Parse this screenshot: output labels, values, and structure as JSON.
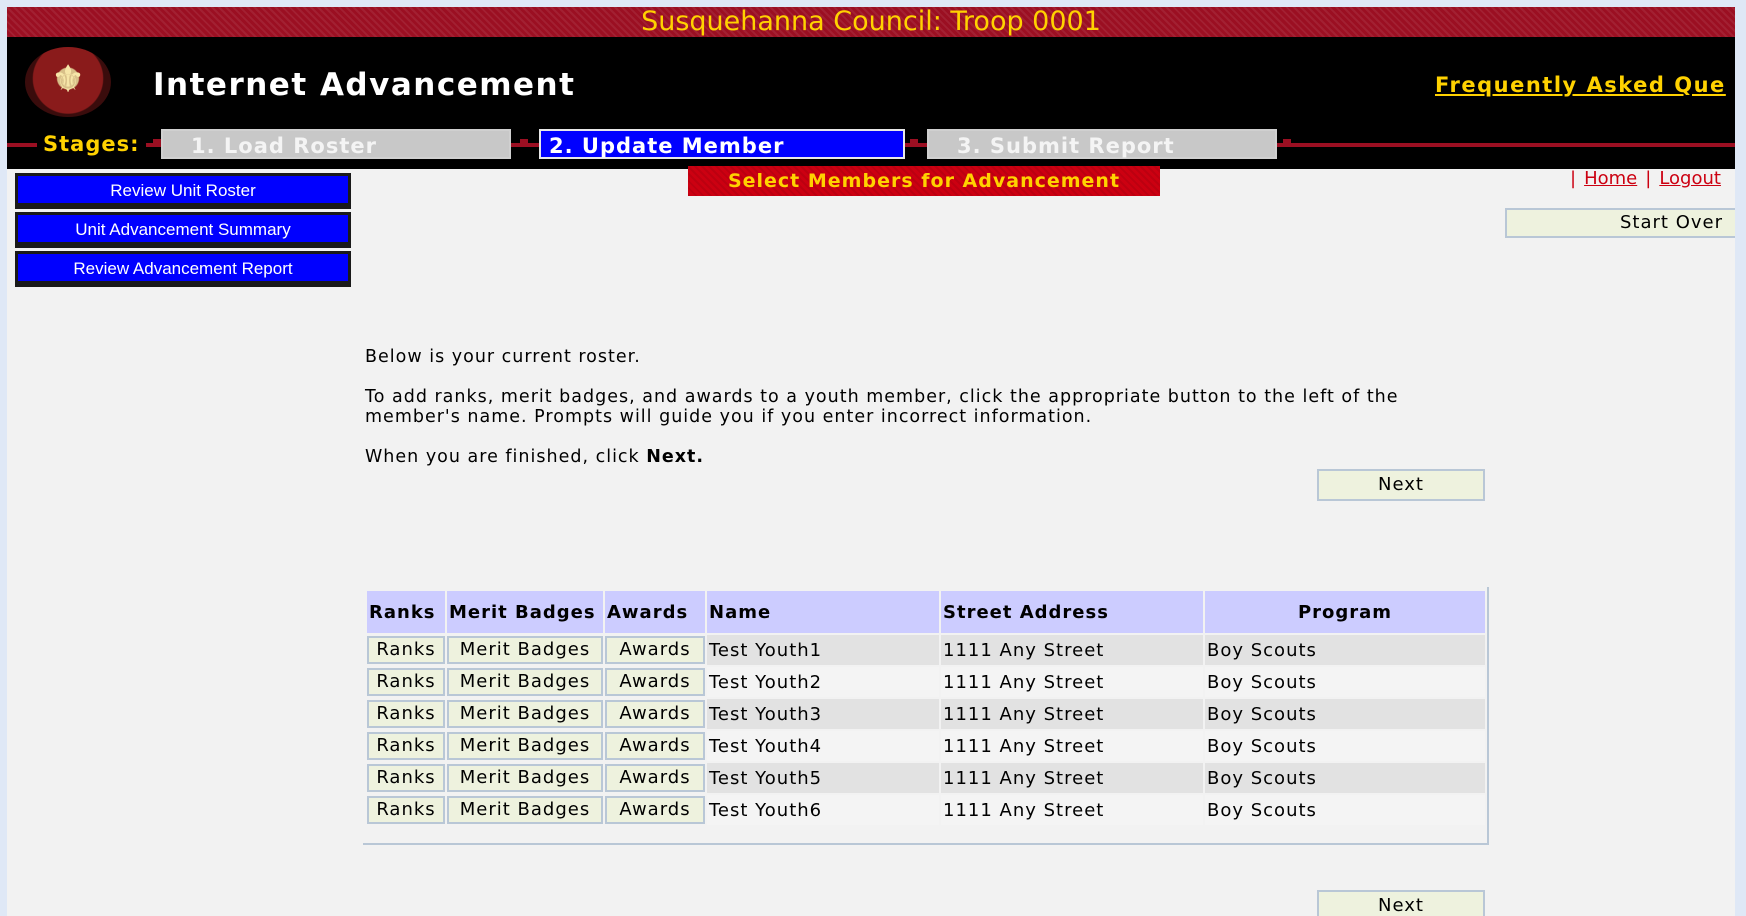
{
  "council_title": "Susquehanna Council: Troop 0001",
  "app_title": "Internet Advancement",
  "faq_link": "Frequently Asked Que",
  "stages": {
    "label": "Stages:",
    "items": [
      {
        "label": "1. Load Roster",
        "state": "inactive"
      },
      {
        "label": "2. Update Member",
        "state": "active"
      },
      {
        "label": "3. Submit Report",
        "state": "inactive"
      }
    ]
  },
  "nav": {
    "items": [
      "Review Unit Roster",
      "Unit Advancement Summary",
      "Review Advancement Report"
    ]
  },
  "section_title": "Select Members for Advancement",
  "top_links": {
    "home": "Home",
    "logout": "Logout"
  },
  "start_over": "Start Over",
  "instructions": {
    "p1": "Below is your current roster.",
    "p2": "To add ranks, merit badges, and awards to a youth member, click the appropriate button to the left of the member's name.  Prompts will guide you if you enter incorrect information.",
    "p3_prefix": "When you are finished, click ",
    "p3_bold": "Next."
  },
  "next_label": "Next",
  "table": {
    "headers": {
      "ranks": "Ranks",
      "merit_badges": "Merit Badges",
      "awards": "Awards",
      "name": "Name",
      "street_address": "Street Address",
      "program": "Program"
    },
    "button_labels": {
      "ranks": "Ranks",
      "merit_badges": "Merit Badges",
      "awards": "Awards"
    },
    "rows": [
      {
        "name": "Test Youth1",
        "address": "1111 Any Street",
        "program": "Boy Scouts"
      },
      {
        "name": "Test Youth2",
        "address": "1111 Any Street",
        "program": "Boy Scouts"
      },
      {
        "name": "Test Youth3",
        "address": "1111 Any Street",
        "program": "Boy Scouts"
      },
      {
        "name": "Test Youth4",
        "address": "1111 Any Street",
        "program": "Boy Scouts"
      },
      {
        "name": "Test Youth5",
        "address": "1111 Any Street",
        "program": "Boy Scouts"
      },
      {
        "name": "Test Youth6",
        "address": "1111 Any Street",
        "program": "Boy Scouts"
      }
    ]
  },
  "colors": {
    "council_bar": "#9b0f22",
    "header_bg": "#000000",
    "accent_yellow": "#ffd200",
    "active_stage": "#0000ff",
    "nav_button": "#0000ff",
    "section_banner": "#cc0011",
    "table_header": "#ccccff"
  }
}
